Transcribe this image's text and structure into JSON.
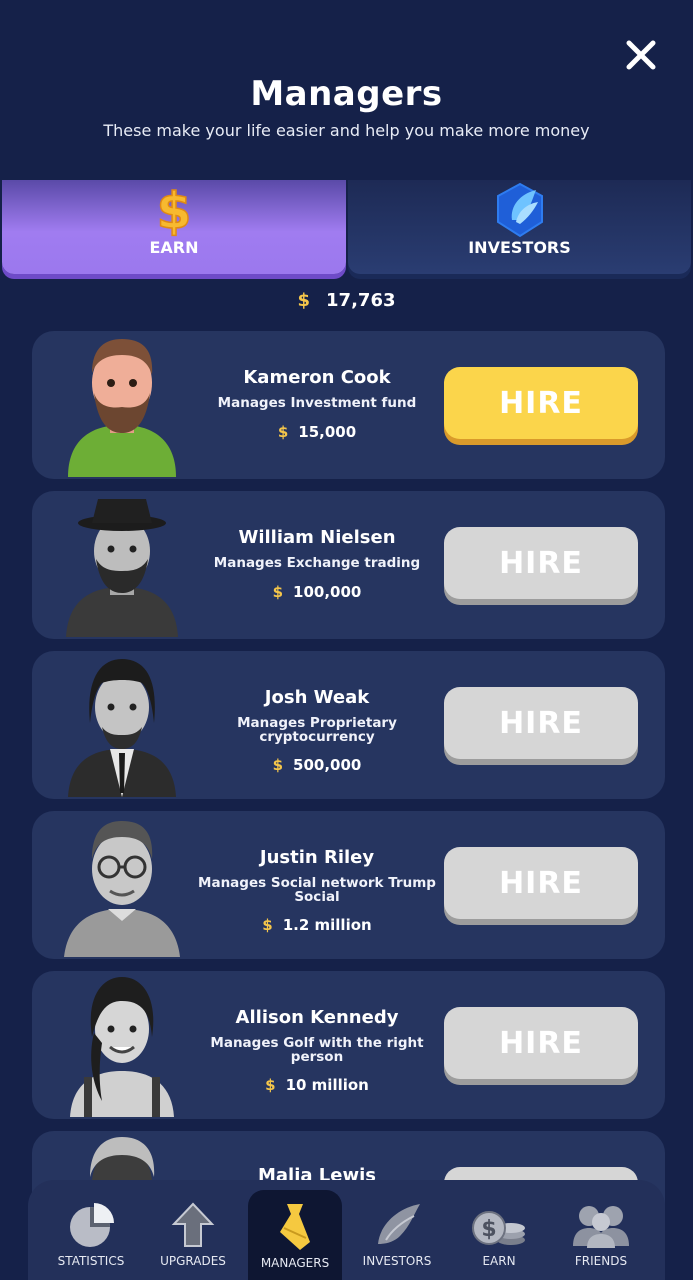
{
  "header": {
    "title": "Managers",
    "subtitle": "These make your life easier and help you make more money",
    "close_icon": "close-icon"
  },
  "tabs": [
    {
      "label": "EARN",
      "icon": "dollar-icon",
      "active": true
    },
    {
      "label": "INVESTORS",
      "icon": "shield-wing-icon",
      "active": false
    }
  ],
  "balance": {
    "currency": "$",
    "value": "17,763"
  },
  "managers": [
    {
      "name": "Kameron  Cook",
      "desc": "Manages Investment fund",
      "currency": "$",
      "cost": "15,000",
      "button": "HIRE",
      "state": "active"
    },
    {
      "name": "William  Nielsen",
      "desc": "Manages Exchange trading",
      "currency": "$",
      "cost": "100,000",
      "button": "HIRE",
      "state": "disabled"
    },
    {
      "name": "Josh Weak",
      "desc": "Manages Proprietary cryptocurrency",
      "currency": "$",
      "cost": "500,000",
      "button": "HIRE",
      "state": "disabled"
    },
    {
      "name": "Justin  Riley",
      "desc": "Manages Social network Trump Social",
      "currency": "$",
      "cost": "1.2 million",
      "button": "HIRE",
      "state": "disabled"
    },
    {
      "name": "Allison  Kennedy",
      "desc": "Manages Golf with the right person",
      "currency": "$",
      "cost": "10 million",
      "button": "HIRE",
      "state": "disabled"
    },
    {
      "name": "Malia  Lewis",
      "desc": "",
      "currency": "",
      "cost": "",
      "button": "",
      "state": "disabled"
    }
  ],
  "nav": [
    {
      "label": "STATISTICS",
      "icon": "pie-chart-icon",
      "active": false
    },
    {
      "label": "UPGRADES",
      "icon": "arrow-up-icon",
      "active": false
    },
    {
      "label": "MANAGERS",
      "icon": "tie-icon",
      "active": true
    },
    {
      "label": "INVESTORS",
      "icon": "wing-icon",
      "active": false
    },
    {
      "label": "EARN",
      "icon": "coins-icon",
      "active": false
    },
    {
      "label": "FRIENDS",
      "icon": "friends-icon",
      "active": false
    }
  ],
  "colors": {
    "background": "#152149",
    "card": "#263560",
    "accent_gold": "#f5c64a",
    "hire_active": "#fbd54b",
    "hire_disabled": "#d6d6d6",
    "tab_active": "#9b78ee"
  }
}
